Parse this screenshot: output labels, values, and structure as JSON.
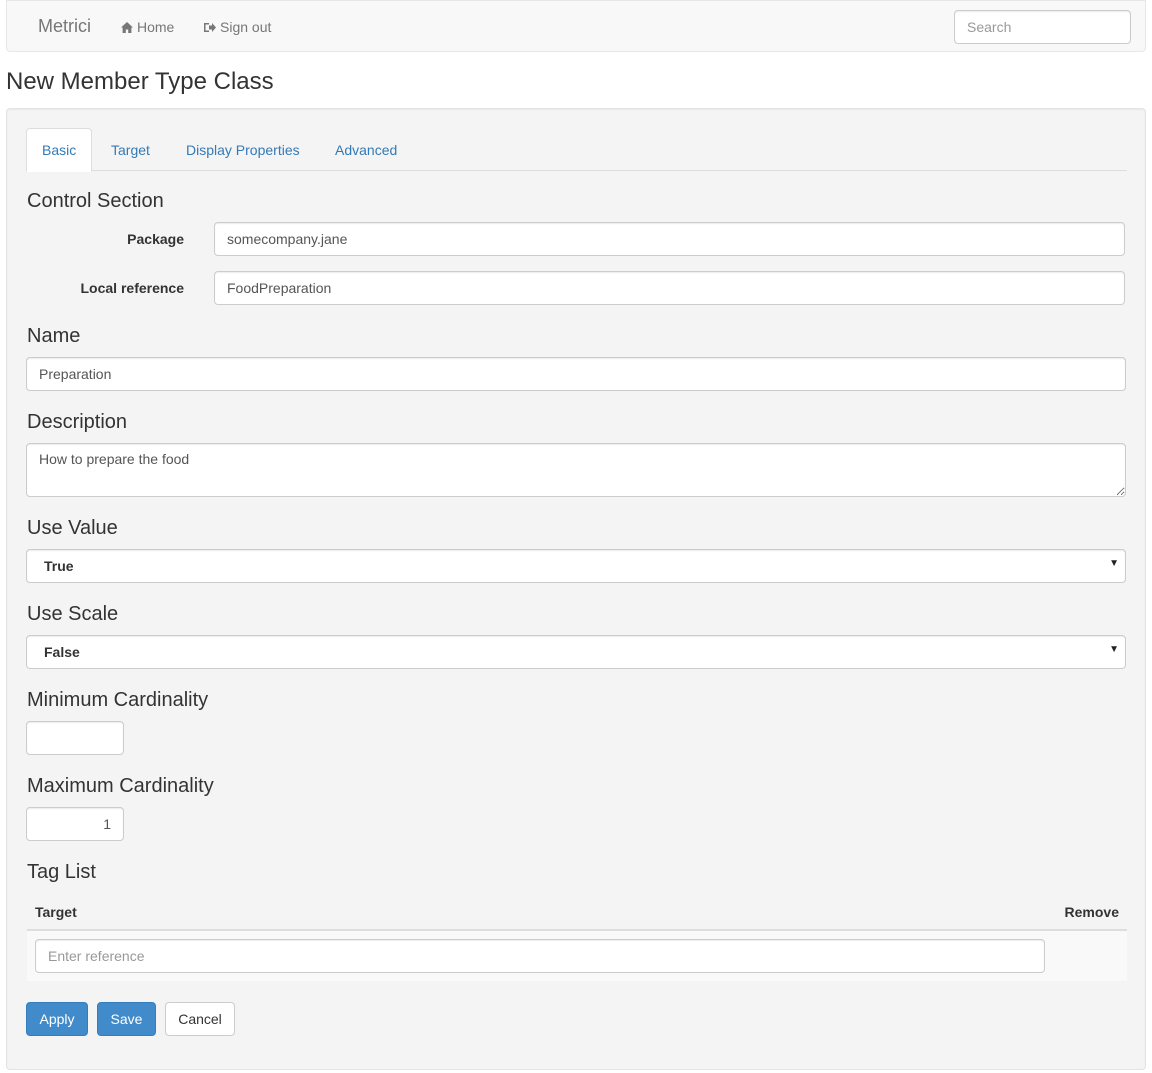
{
  "navbar": {
    "brand": "Metrici",
    "links": [
      {
        "label": "Home",
        "icon": "home-icon"
      },
      {
        "label": "Sign out",
        "icon": "sign-out-icon"
      }
    ],
    "search_placeholder": "Search"
  },
  "page": {
    "title": "New Member Type Class"
  },
  "tabs": [
    {
      "label": "Basic",
      "active": true
    },
    {
      "label": "Target",
      "active": false
    },
    {
      "label": "Display Properties",
      "active": false
    },
    {
      "label": "Advanced",
      "active": false
    }
  ],
  "control_section": {
    "heading": "Control Section",
    "package_label": "Package",
    "package_value": "somecompany.jane",
    "local_ref_label": "Local reference",
    "local_ref_value": "FoodPreparation"
  },
  "name": {
    "label": "Name",
    "value": "Preparation"
  },
  "description": {
    "label": "Description",
    "value": "How to prepare the food"
  },
  "use_value": {
    "label": "Use Value",
    "selected": "True"
  },
  "use_scale": {
    "label": "Use Scale",
    "selected": "False"
  },
  "min_cardinality": {
    "label": "Minimum Cardinality",
    "value": ""
  },
  "max_cardinality": {
    "label": "Maximum Cardinality",
    "value": "1"
  },
  "tag_list": {
    "heading": "Tag List",
    "columns": [
      "Target",
      "Remove"
    ],
    "input_placeholder": "Enter reference"
  },
  "buttons": {
    "apply": "Apply",
    "save": "Save",
    "cancel": "Cancel"
  },
  "colors": {
    "primary": "#428bca",
    "link": "#337ab7"
  }
}
